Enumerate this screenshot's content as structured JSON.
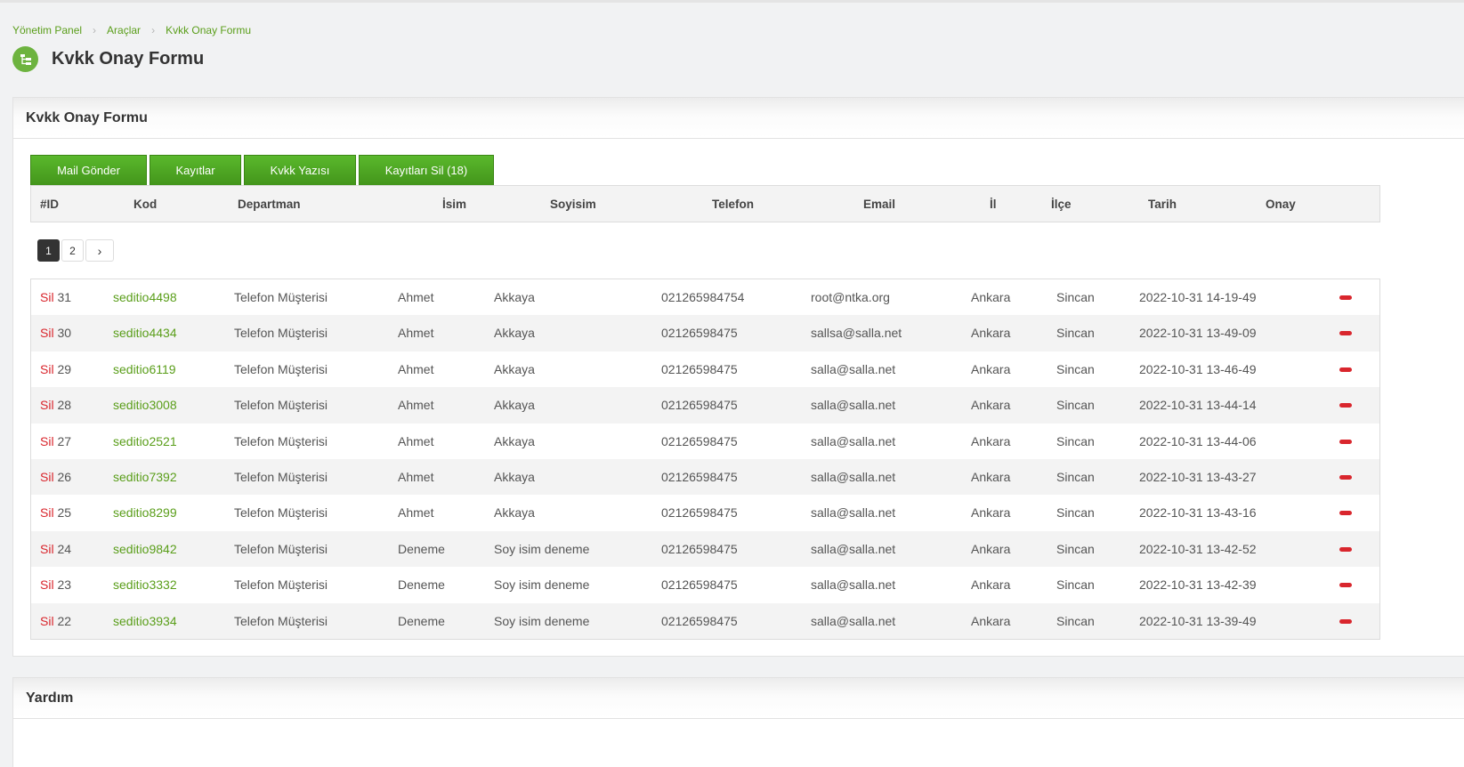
{
  "breadcrumb": {
    "items": [
      "Yönetim Panel",
      "Araçlar",
      "Kvkk Onay Formu"
    ]
  },
  "page": {
    "title": "Kvkk Onay Formu",
    "icon": "sitemap-icon"
  },
  "panel": {
    "title": "Kvkk Onay Formu"
  },
  "toolbar": {
    "mail": "Mail Gönder",
    "records": "Kayıtlar",
    "text": "Kvkk Yazısı",
    "delete_all": "Kayıtları Sil (18)"
  },
  "columns": [
    "#ID",
    "Kod",
    "Departman",
    "İsim",
    "Soyisim",
    "Telefon",
    "Email",
    "İl",
    "İlçe",
    "Tarih",
    "Onay"
  ],
  "pagination": {
    "pages": [
      "1",
      "2"
    ],
    "current": "1",
    "next": "›"
  },
  "rows": [
    {
      "sil": "Sil",
      "id": "31",
      "kod": "seditio4498",
      "dep": "Telefon Müşterisi",
      "isim": "Ahmet",
      "soyisim": "Akkaya",
      "tel": "021265984754",
      "email": "root@ntka.org",
      "il": "Ankara",
      "ilce": "Sincan",
      "tarih": "2022-10-31 14-19-49"
    },
    {
      "sil": "Sil",
      "id": "30",
      "kod": "seditio4434",
      "dep": "Telefon Müşterisi",
      "isim": "Ahmet",
      "soyisim": "Akkaya",
      "tel": "02126598475",
      "email": "sallsa@salla.net",
      "il": "Ankara",
      "ilce": "Sincan",
      "tarih": "2022-10-31 13-49-09"
    },
    {
      "sil": "Sil",
      "id": "29",
      "kod": "seditio6119",
      "dep": "Telefon Müşterisi",
      "isim": "Ahmet",
      "soyisim": "Akkaya",
      "tel": "02126598475",
      "email": "salla@salla.net",
      "il": "Ankara",
      "ilce": "Sincan",
      "tarih": "2022-10-31 13-46-49"
    },
    {
      "sil": "Sil",
      "id": "28",
      "kod": "seditio3008",
      "dep": "Telefon Müşterisi",
      "isim": "Ahmet",
      "soyisim": "Akkaya",
      "tel": "02126598475",
      "email": "salla@salla.net",
      "il": "Ankara",
      "ilce": "Sincan",
      "tarih": "2022-10-31 13-44-14"
    },
    {
      "sil": "Sil",
      "id": "27",
      "kod": "seditio2521",
      "dep": "Telefon Müşterisi",
      "isim": "Ahmet",
      "soyisim": "Akkaya",
      "tel": "02126598475",
      "email": "salla@salla.net",
      "il": "Ankara",
      "ilce": "Sincan",
      "tarih": "2022-10-31 13-44-06"
    },
    {
      "sil": "Sil",
      "id": "26",
      "kod": "seditio7392",
      "dep": "Telefon Müşterisi",
      "isim": "Ahmet",
      "soyisim": "Akkaya",
      "tel": "02126598475",
      "email": "salla@salla.net",
      "il": "Ankara",
      "ilce": "Sincan",
      "tarih": "2022-10-31 13-43-27"
    },
    {
      "sil": "Sil",
      "id": "25",
      "kod": "seditio8299",
      "dep": "Telefon Müşterisi",
      "isim": "Ahmet",
      "soyisim": "Akkaya",
      "tel": "02126598475",
      "email": "salla@salla.net",
      "il": "Ankara",
      "ilce": "Sincan",
      "tarih": "2022-10-31 13-43-16"
    },
    {
      "sil": "Sil",
      "id": "24",
      "kod": "seditio9842",
      "dep": "Telefon Müşterisi",
      "isim": "Deneme",
      "soyisim": "Soy isim deneme",
      "tel": "02126598475",
      "email": "salla@salla.net",
      "il": "Ankara",
      "ilce": "Sincan",
      "tarih": "2022-10-31 13-42-52"
    },
    {
      "sil": "Sil",
      "id": "23",
      "kod": "seditio3332",
      "dep": "Telefon Müşterisi",
      "isim": "Deneme",
      "soyisim": "Soy isim deneme",
      "tel": "02126598475",
      "email": "salla@salla.net",
      "il": "Ankara",
      "ilce": "Sincan",
      "tarih": "2022-10-31 13-42-39"
    },
    {
      "sil": "Sil",
      "id": "22",
      "kod": "seditio3934",
      "dep": "Telefon Müşterisi",
      "isim": "Deneme",
      "soyisim": "Soy isim deneme",
      "tel": "02126598475",
      "email": "salla@salla.net",
      "il": "Ankara",
      "ilce": "Sincan",
      "tarih": "2022-10-31 13-39-49"
    }
  ],
  "help": {
    "title": "Yardım"
  },
  "colors": {
    "accent": "#5a9e1a",
    "button": "#4ca521",
    "danger": "#d9262d"
  }
}
